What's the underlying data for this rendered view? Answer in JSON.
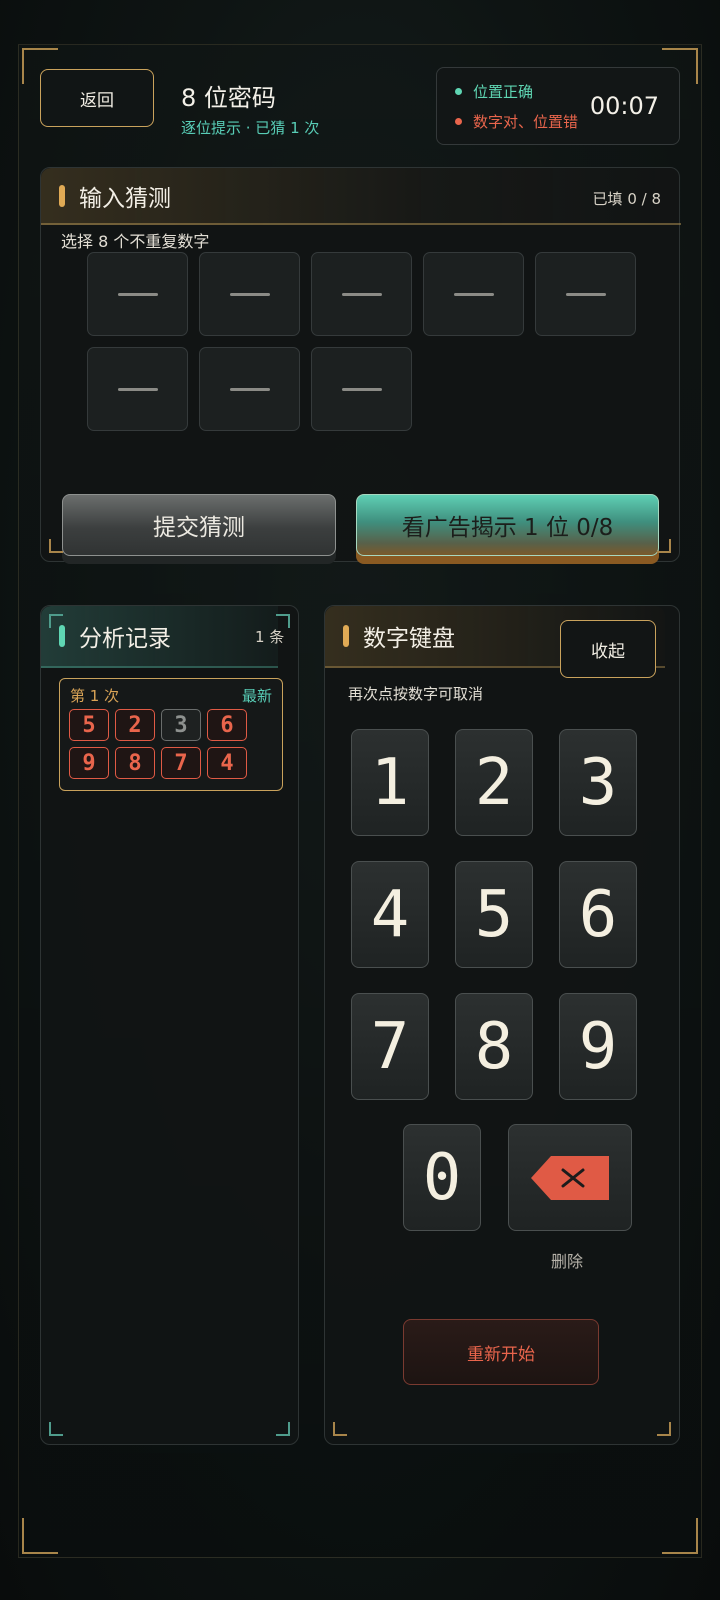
{
  "header": {
    "back_label": "返回",
    "title": "8 位密码",
    "subtitle": "逐位提示 · 已猜 1 次",
    "legend_correct": "位置正确",
    "legend_misplaced": "数字对、位置错",
    "timer": "00:07"
  },
  "input_panel": {
    "title": "输入猜测",
    "filled_count": "已填 0 / 8",
    "hint": "选择 8 个不重复数字",
    "slots": [
      "",
      "",
      "",
      "",
      "",
      "",
      "",
      ""
    ],
    "submit_label": "提交猜测",
    "ad_reveal_label": "看广告揭示 1 位 0/8"
  },
  "analysis_panel": {
    "title": "分析记录",
    "count": "1 条",
    "records": [
      {
        "label": "第 1 次",
        "badge": "最新",
        "digits": [
          "5",
          "2",
          "3",
          "6",
          "9",
          "8",
          "7",
          "4"
        ],
        "states": [
          "misplaced",
          "misplaced",
          "absent",
          "misplaced",
          "misplaced",
          "misplaced",
          "misplaced",
          "misplaced"
        ]
      }
    ]
  },
  "keypad_panel": {
    "title": "数字键盘",
    "collapse_label": "收起",
    "hint": "再次点按数字可取消",
    "keys": [
      "1",
      "2",
      "3",
      "4",
      "5",
      "6",
      "7",
      "8",
      "9",
      "0"
    ],
    "delete_label": "删除",
    "restart_label": "重新开始"
  },
  "colors": {
    "accent_gold": "#c9a25c",
    "correct": "#5fd6b3",
    "misplaced": "#e9654c",
    "teal_text": "#58cdb6"
  }
}
